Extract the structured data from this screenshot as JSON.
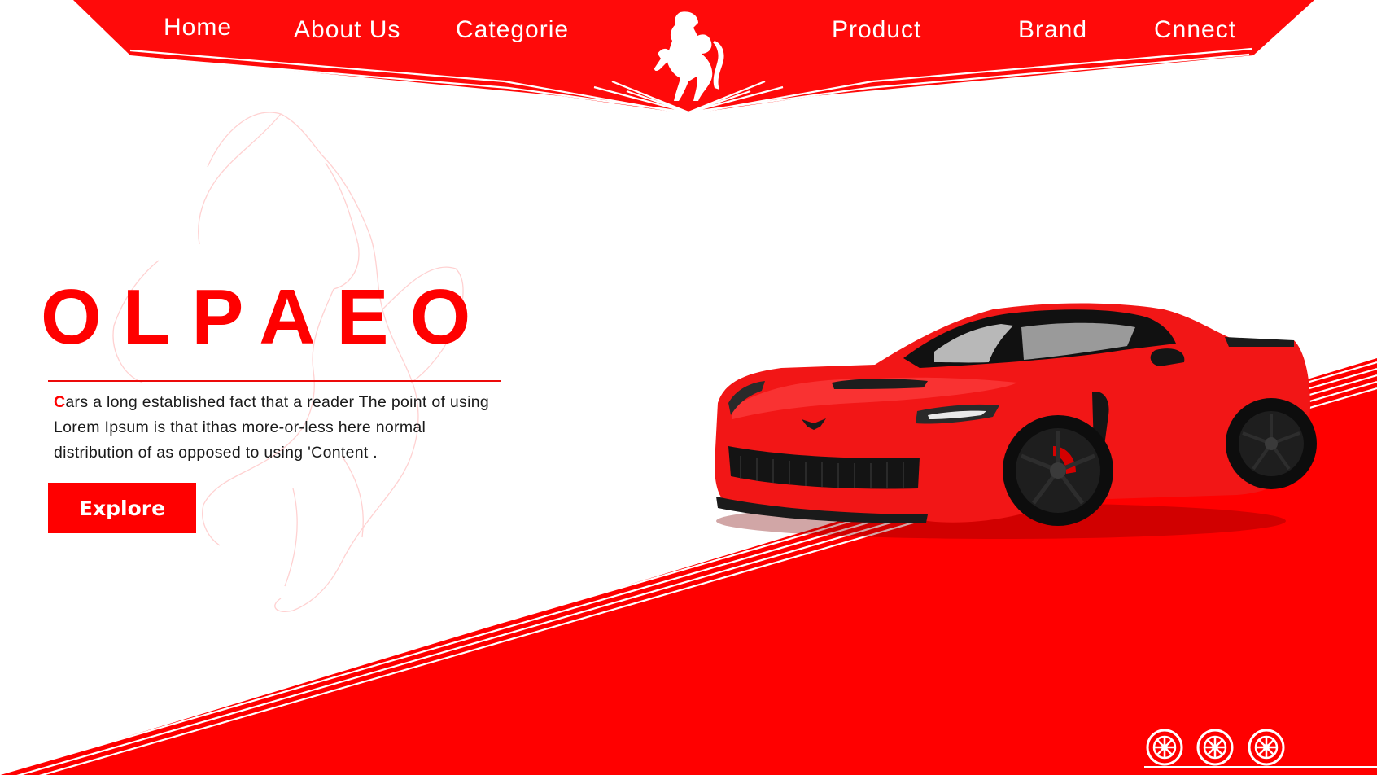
{
  "nav": {
    "items": [
      {
        "label": "Home"
      },
      {
        "label": "About Us"
      },
      {
        "label": "Categorie"
      },
      {
        "label": "Product"
      },
      {
        "label": "Brand"
      },
      {
        "label": "Cnnect"
      }
    ],
    "logo": "prancing-horse-logo-icon"
  },
  "hero": {
    "title": "OLPAEO",
    "text_first_letter": "C",
    "text_rest": "ars a long established fact that a reader The point of using Lorem Ipsum is that ithas more-or-less here normal distribution of as opposed to using 'Content .",
    "button_label": "Explore"
  },
  "decor": {
    "car": "red-sports-car-image",
    "watermark": "horse-outline-watermark",
    "wheels": [
      "wheel-icon",
      "wheel-icon",
      "wheel-icon"
    ]
  },
  "colors": {
    "accent": "#ff0000",
    "header": "#ff0a0a",
    "text": "#1a1a1a",
    "background": "#ffffff"
  }
}
